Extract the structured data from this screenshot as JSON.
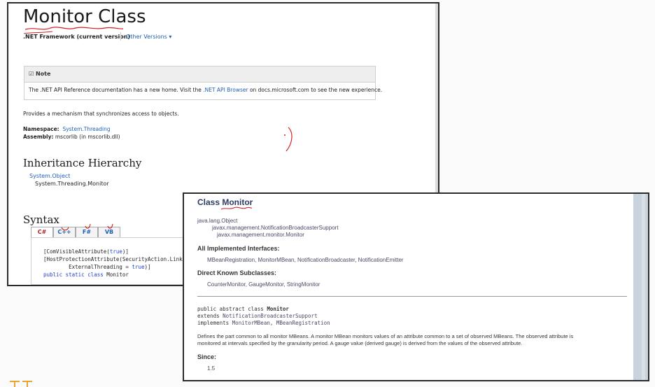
{
  "doc1": {
    "title": "Monitor Class",
    "framework": ".NET Framework (current version)",
    "other_versions": "Other Versions ▾",
    "note": {
      "heading": "Note",
      "text_before": "The .NET API Reference documentation has a new home. Visit the ",
      "link": ".NET API Browser",
      "text_after": " on docs.microsoft.com to see the new experience."
    },
    "description": "Provides a mechanism that synchronizes access to objects.",
    "namespace_label": "Namespace:",
    "namespace_value": "System.Threading",
    "assembly_label": "Assembly:",
    "assembly_value": "mscorlib (in mscorlib.dll)",
    "inheritance_heading": "Inheritance Hierarchy",
    "inheritance": [
      "System.Object",
      "System.Threading.Monitor"
    ],
    "syntax_heading": "Syntax",
    "tabs": [
      "C#",
      "C++",
      "F#",
      "VB"
    ],
    "code": {
      "l1_a": "[ComVisibleAttribute(",
      "l1_kw": "true",
      "l1_b": ")]",
      "l2": "[HostProtectionAttribute(SecurityAction.LinkDemand, Synchronization = true,",
      "l3_a": "        ExternalThreading = ",
      "l3_kw": "true",
      "l3_b": ")]",
      "l4_kw": "public static class",
      "l4_b": " Monitor"
    }
  },
  "doc2": {
    "title": "Class Monitor",
    "hierarchy": [
      "java.lang.Object",
      "javax.management.NotificationBroadcasterSupport",
      "javax.management.monitor.Monitor"
    ],
    "interfaces_heading": "All Implemented Interfaces:",
    "interfaces": "MBeanRegistration, MonitorMBean, NotificationBroadcaster, NotificationEmitter",
    "subclasses_heading": "Direct Known Subclasses:",
    "subclasses": "CounterMonitor, GaugeMonitor, StringMonitor",
    "decl_a": "public abstract class ",
    "decl_name": "Monitor",
    "decl_extends": "extends ",
    "decl_extends_link": "NotificationBroadcasterSupport",
    "decl_implements": "implements ",
    "decl_implements_link": "MonitorMBean, MBeanRegistration",
    "desc_line1": "Defines the part common to all monitor MBeans. A monitor MBean monitors values of an attribute common to a set of observed MBeans. The observed attribute is",
    "desc_line2": "monitored at intervals specified by the granularity period. A gauge value (derived gauge) is derived from the values of the observed attribute.",
    "since_heading": "Since:",
    "since_value": "1.5"
  },
  "colors": {
    "link_blue": "#1f5fb5",
    "annotation_red": "#d42020",
    "java_heading": "#2a3b66",
    "logo_orange": "#e8a531"
  }
}
